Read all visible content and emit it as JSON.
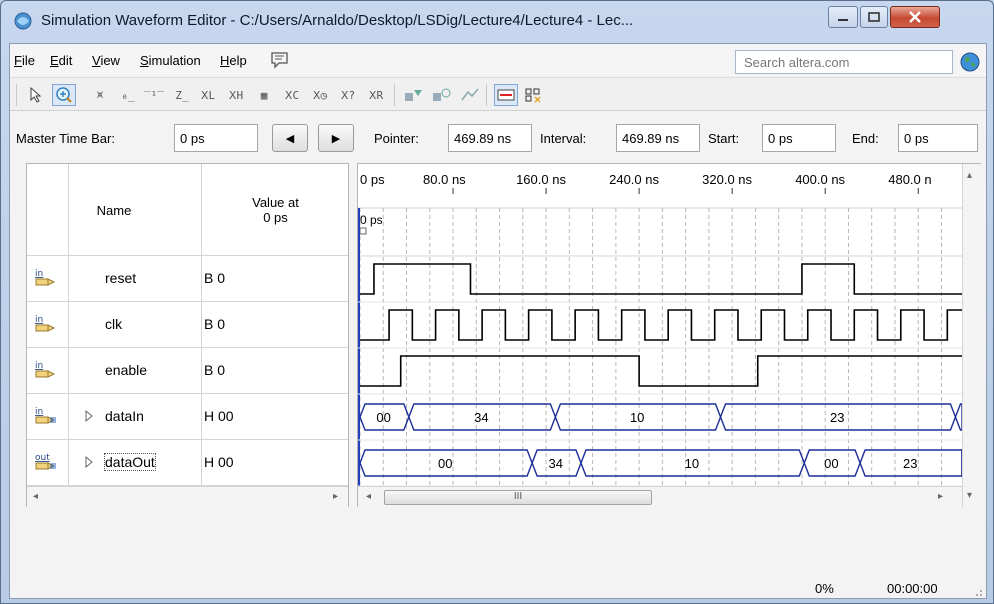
{
  "window": {
    "title": "Simulation Waveform Editor - C:/Users/Arnaldo/Desktop/LSDig/Lecture4/Lecture4 - Lec..."
  },
  "menu": {
    "items": [
      {
        "label": "File",
        "accel": "F"
      },
      {
        "label": "Edit",
        "accel": "E"
      },
      {
        "label": "View",
        "accel": "V"
      },
      {
        "label": "Simulation",
        "accel": "S"
      },
      {
        "label": "Help",
        "accel": "H"
      }
    ],
    "search_placeholder": "Search altera.com"
  },
  "toolbar": {
    "tools": [
      "selection-tool-icon",
      "zoom-tool-icon",
      "force-unknown-icon",
      "force-low-icon",
      "force-high-icon",
      "force-high-impedance-icon",
      "force-weak-low-icon",
      "force-weak-high-icon",
      "invert-icon",
      "count-value-icon",
      "forcing-clock-icon",
      "arbitrary-value-icon",
      "random-value-icon",
      "run-functional-simulation-icon",
      "run-timing-simulation-icon",
      "generate-netlist-icon",
      "snap-to-grid-icon",
      "sort-signals-icon"
    ]
  },
  "timebar": {
    "master_label": "Master Time Bar:",
    "master_value": "0 ps",
    "pointer_label": "Pointer:",
    "pointer_value": "469.89 ns",
    "interval_label": "Interval:",
    "interval_value": "469.89 ns",
    "start_label": "Start:",
    "start_value": "0 ps",
    "end_label": "End:",
    "end_value": "0 ps"
  },
  "table": {
    "col_name": "Name",
    "col_value": "Value at\n0 ps",
    "signals": [
      {
        "type": "in",
        "name": "reset",
        "value": "B 0",
        "bus": false
      },
      {
        "type": "in",
        "name": "clk",
        "value": "B 0",
        "bus": false
      },
      {
        "type": "in",
        "name": "enable",
        "value": "B 0",
        "bus": false
      },
      {
        "type": "in",
        "name": "dataIn",
        "value": "H 00",
        "bus": true
      },
      {
        "type": "out",
        "name": "dataOut",
        "value": "H 00",
        "bus": true
      }
    ]
  },
  "waveform": {
    "time_ticks": [
      "0 ps",
      "80.0 ns",
      "160.0 ns",
      "240.0 ns",
      "320.0 ns",
      "400.0 ns",
      "480.0 n"
    ],
    "cursor_label": "0 ps",
    "reset": [
      [
        0,
        0
      ],
      [
        12,
        1
      ],
      [
        95,
        0
      ],
      [
        380,
        1
      ],
      [
        425,
        0
      ]
    ],
    "clk_period_ns": 40,
    "enable": [
      [
        0,
        0
      ],
      [
        35,
        1
      ],
      [
        240,
        0
      ],
      [
        342,
        1
      ],
      [
        580,
        0
      ]
    ],
    "dataIn": [
      {
        "start": 0,
        "end": 42,
        "label": "00"
      },
      {
        "start": 42,
        "end": 168,
        "label": "34"
      },
      {
        "start": 168,
        "end": 310,
        "label": "10"
      },
      {
        "start": 310,
        "end": 512,
        "label": "23"
      },
      {
        "start": 512,
        "end": 600,
        "label": ""
      }
    ],
    "dataOut": [
      {
        "start": 0,
        "end": 148,
        "label": "00"
      },
      {
        "start": 148,
        "end": 190,
        "label": "34"
      },
      {
        "start": 190,
        "end": 382,
        "label": "10"
      },
      {
        "start": 382,
        "end": 430,
        "label": "00"
      },
      {
        "start": 430,
        "end": 565,
        "label": "23"
      },
      {
        "start": 565,
        "end": 600,
        "label": ""
      }
    ]
  },
  "scroll": {
    "thumb_label": "III"
  },
  "status": {
    "percent": "0%",
    "elapsed": "00:00:00"
  }
}
